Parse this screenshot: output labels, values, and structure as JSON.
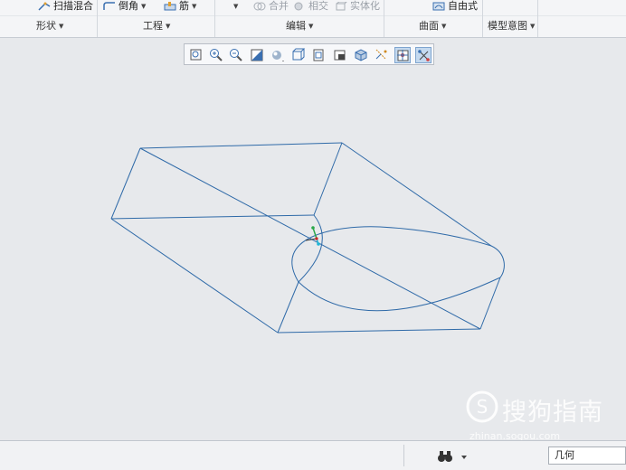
{
  "ribbon": {
    "shape": {
      "sweep_blend": "扫描混合",
      "label": "形状"
    },
    "engineering": {
      "round": "倒角",
      "rib": "筋",
      "label": "工程"
    },
    "editing": {
      "merge": "合并",
      "intersect": "相交",
      "solidify": "实体化",
      "label": "编辑"
    },
    "surfaces": {
      "freestyle": "自由式",
      "label": "曲面"
    },
    "model_intent": {
      "label": "模型意图"
    }
  },
  "view_toolbar": {
    "icons": [
      "refit-icon",
      "zoom-in-icon",
      "zoom-out-icon",
      "repaint-icon",
      "display-style-icon",
      "saved-orientations-icon",
      "named-views-icon",
      "view-manager-icon",
      "perspective-icon",
      "datum-display-icon",
      "spin-center-icon",
      "annotation-display-icon"
    ]
  },
  "statusbar": {
    "filter_value": "几何"
  },
  "watermark": {
    "text": "搜狗指南",
    "url": "zhinan.sogou.com"
  },
  "colors": {
    "model_edge": "#2f6aa8",
    "canvas_bg": "#e7e9ec",
    "ribbon_bg": "#f4f5f7"
  }
}
